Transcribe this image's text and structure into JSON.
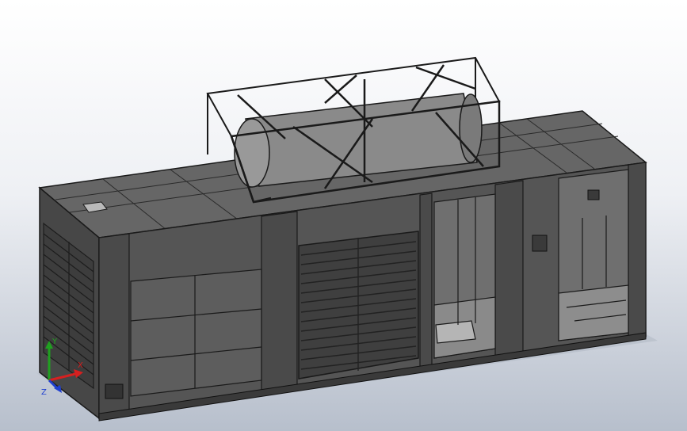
{
  "colors": {
    "background_top": "#ffffff",
    "background_bottom": "#b7bfcc",
    "panel_dark": "#4d4d4d",
    "panel_mid": "#5b5b5b",
    "roof": "#636363",
    "edge": "#1a1a1a",
    "tank": "#8d8d8d",
    "x_axis": "#d62020",
    "y_axis": "#20a020",
    "z_axis": "#2040d0"
  },
  "triad": {
    "x_label": "X",
    "y_label": "Y",
    "z_label": "Z"
  },
  "icons": {
    "triad": "coordinate-triad-icon"
  }
}
